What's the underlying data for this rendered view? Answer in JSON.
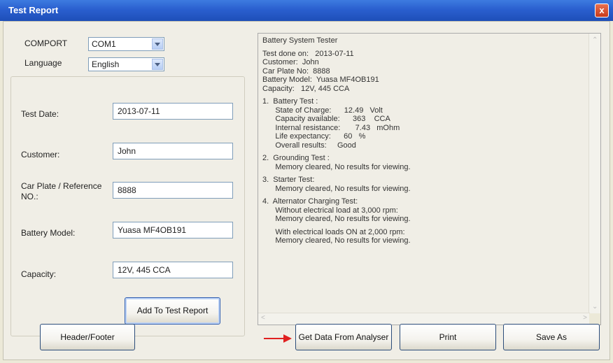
{
  "window": {
    "title": "Test Report",
    "close_glyph": "x"
  },
  "settings": {
    "comport": {
      "label": "COMPORT",
      "value": "COM1"
    },
    "language": {
      "label": "Language",
      "value": "English"
    }
  },
  "form": {
    "test_date": {
      "label": "Test Date:",
      "value": "2013-07-11"
    },
    "customer": {
      "label": "Customer:",
      "value": "John"
    },
    "car_plate": {
      "label_line1": "Car Plate / Reference",
      "label_line2": "NO.:",
      "value": "8888"
    },
    "battery_model": {
      "label": "Battery Model:",
      "value": "Yuasa MF4OB191"
    },
    "capacity": {
      "label": "Capacity:",
      "value": "12V, 445 CCA"
    },
    "add_button": "Add To Test Report"
  },
  "report": {
    "lines": [
      "Battery System Tester",
      "",
      "Test done on:   2013-07-11",
      "Customer:  John",
      "Car Plate No:  8888",
      "Battery Model:  Yuasa MF4OB191",
      "Capacity:   12V, 445 CCA",
      "",
      "1.  Battery Test :",
      "      State of Charge:      12.49   Volt",
      "      Capacity available:      363    CCA",
      "      Internal resistance:       7.43   mOhm",
      "      Life expectancy:      60   %",
      "      Overall results:     Good",
      "",
      "2.  Grounding Test :",
      "      Memory cleared, No results for viewing.",
      "",
      "3.  Starter Test:",
      "      Memory cleared, No results for viewing.",
      "",
      "4.  Alternator Charging Test:",
      "      Without electrical load at 3,000 rpm:",
      "      Memory cleared, No results for viewing.",
      "",
      "      With electrical loads ON at 2,000 rpm:",
      "      Memory cleared, No results for viewing."
    ]
  },
  "buttons": {
    "header_footer": "Header/Footer",
    "get_data": "Get Data From Analyser",
    "print": "Print",
    "save_as": "Save As"
  },
  "colors": {
    "annotation_arrow": "#e02020",
    "title_bar": "#2a5fcf"
  }
}
